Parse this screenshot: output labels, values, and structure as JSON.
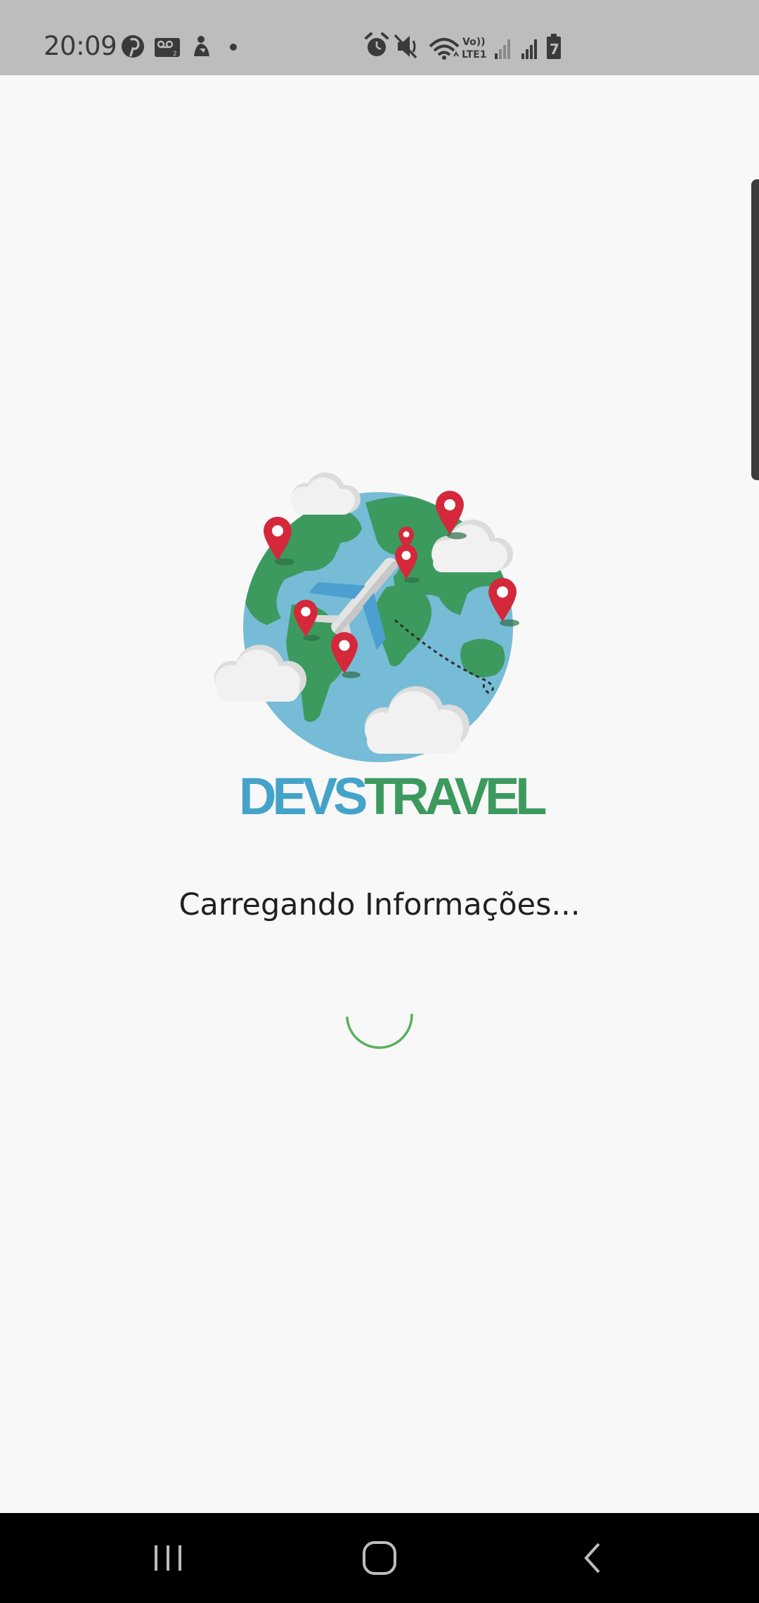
{
  "status_bar": {
    "time": "20:09",
    "left_icons": [
      "pinterest-icon",
      "voicemail-icon",
      "shopping-bag-icon",
      "dot-icon"
    ],
    "right_icons": [
      "alarm-icon",
      "mute-icon",
      "wifi-icon",
      "volte-icon",
      "signal-icon",
      "signal-icon",
      "battery-icon"
    ],
    "volte_label_top": "Vo))",
    "volte_label_bottom": "LTE1",
    "battery_level": "7"
  },
  "logo": {
    "brand_part1": "DEVS",
    "brand_part2": "TRAVEL",
    "colors": {
      "ocean": "#76bcd6",
      "land": "#3d9a5f",
      "pin": "#d4283b",
      "plane": "#e4e4e4",
      "plane_accent": "#4c9fd0",
      "cloud": "#f1f1f1",
      "devs": "#44a3c8",
      "travel": "#3d9a5f"
    }
  },
  "loading": {
    "message": "Carregando Informações...",
    "spinner_color": "#5aaf5a"
  },
  "nav_bar": {
    "buttons": [
      "recent-apps",
      "home",
      "back"
    ]
  }
}
